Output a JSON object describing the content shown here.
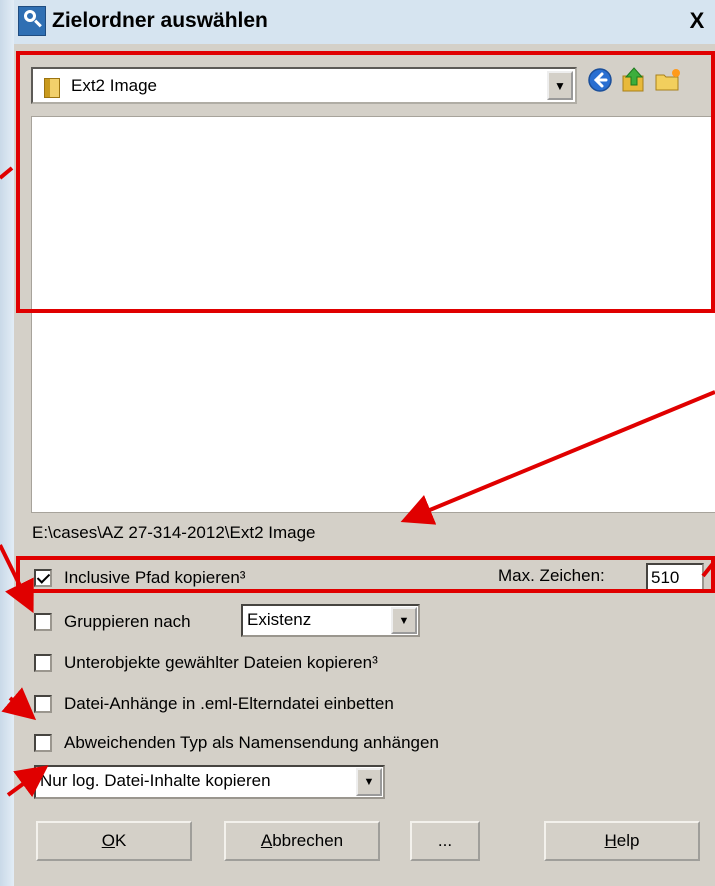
{
  "window": {
    "title": "Zielordner auswählen",
    "close_glyph": "X"
  },
  "folder_combo": {
    "value": "Ext2 Image",
    "icon": "folder-icon"
  },
  "nav_icons": [
    "back-icon",
    "up-folder-icon",
    "new-folder-icon"
  ],
  "folder_list": {
    "items": []
  },
  "path": "E:\\cases\\AZ 27-314-2012\\Ext2 Image",
  "options": {
    "include_path": {
      "label": "Inclusive Pfad kopieren³",
      "checked": true
    },
    "max_chars": {
      "label": "Max. Zeichen:",
      "value": "510"
    },
    "group_by": {
      "label": "Gruppieren nach",
      "checked": false,
      "value": "Existenz"
    },
    "subobjects": {
      "label": "Unterobjekte gewählter Dateien kopieren³",
      "checked": false
    },
    "embed_attachments": {
      "label": "Datei-Anhänge in .eml-Elterndatei einbetten",
      "checked": false
    },
    "append_type": {
      "label": "Abweichenden Typ als Namensendung anhängen",
      "checked": false
    },
    "content_mode": {
      "value": "Nur log. Datei-Inhalte kopieren"
    }
  },
  "buttons": {
    "ok": {
      "mnemonic": "O",
      "rest": "K"
    },
    "cancel": {
      "mnemonic": "A",
      "rest": "bbrechen"
    },
    "more": {
      "label": "..."
    },
    "help": {
      "mnemonic": "H",
      "rest": "elp"
    }
  },
  "colors": {
    "annotation": "#e00000",
    "dialog_bg": "#d4d0c8"
  }
}
